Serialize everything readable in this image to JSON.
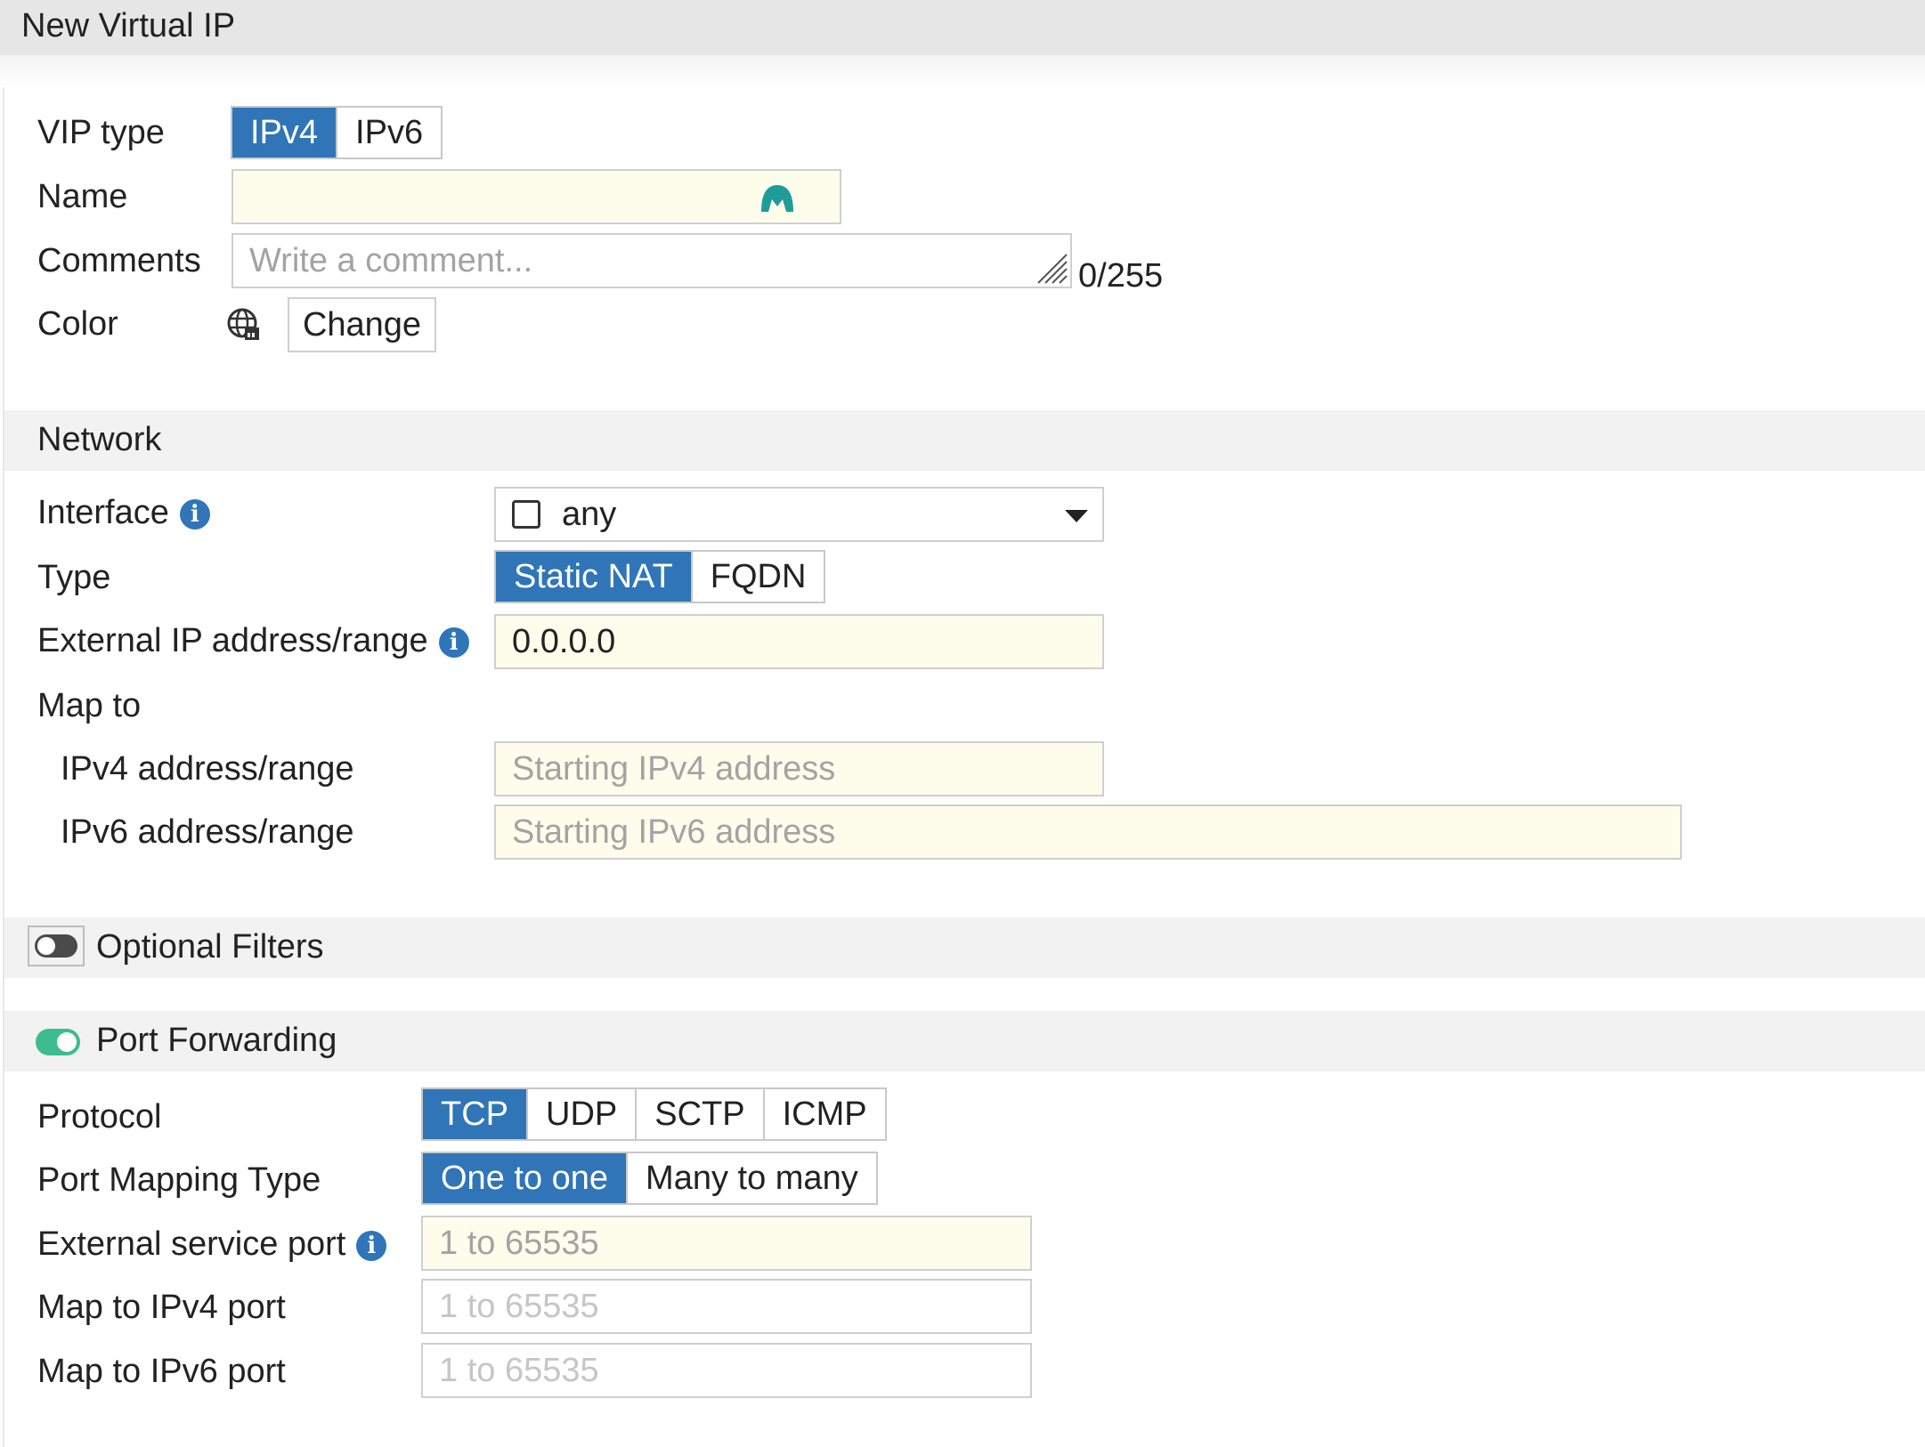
{
  "window": {
    "title": "New Virtual IP"
  },
  "general": {
    "vip_type_label": "VIP type",
    "vip_type_options": [
      "IPv4",
      "IPv6"
    ],
    "vip_type_selected": "IPv4",
    "name_label": "Name",
    "name_value": "",
    "comments_label": "Comments",
    "comments_placeholder": "Write a comment...",
    "comments_counter": "0/255",
    "color_label": "Color",
    "color_change_label": "Change"
  },
  "network": {
    "section_title": "Network",
    "interface_label": "Interface",
    "interface_value": "any",
    "type_label": "Type",
    "type_options": [
      "Static NAT",
      "FQDN"
    ],
    "type_selected": "Static NAT",
    "external_ip_label": "External IP address/range",
    "external_ip_value": "0.0.0.0",
    "map_to_label": "Map to",
    "ipv4_range_label": "IPv4 address/range",
    "ipv4_range_placeholder": "Starting IPv4 address",
    "ipv6_range_label": "IPv6 address/range",
    "ipv6_range_placeholder": "Starting IPv6 address"
  },
  "optional_filters": {
    "label": "Optional Filters",
    "enabled": false
  },
  "port_forwarding": {
    "label": "Port Forwarding",
    "enabled": true,
    "protocol_label": "Protocol",
    "protocol_options": [
      "TCP",
      "UDP",
      "SCTP",
      "ICMP"
    ],
    "protocol_selected": "TCP",
    "mapping_type_label": "Port Mapping Type",
    "mapping_type_options": [
      "One to one",
      "Many to many"
    ],
    "mapping_type_selected": "One to one",
    "external_port_label": "External service port",
    "external_port_placeholder": "1 to 65535",
    "map_ipv4_port_label": "Map to IPv4 port",
    "map_ipv4_port_placeholder": "1 to 65535",
    "map_ipv6_port_label": "Map to IPv6 port",
    "map_ipv6_port_placeholder": "1 to 65535"
  },
  "colors": {
    "accent": "#2f75b8",
    "toggle_on": "#3dbd8f",
    "input_bg": "#fdfdec",
    "section_bg": "#f2f2f2",
    "name_icon": "#1f9c9a"
  }
}
